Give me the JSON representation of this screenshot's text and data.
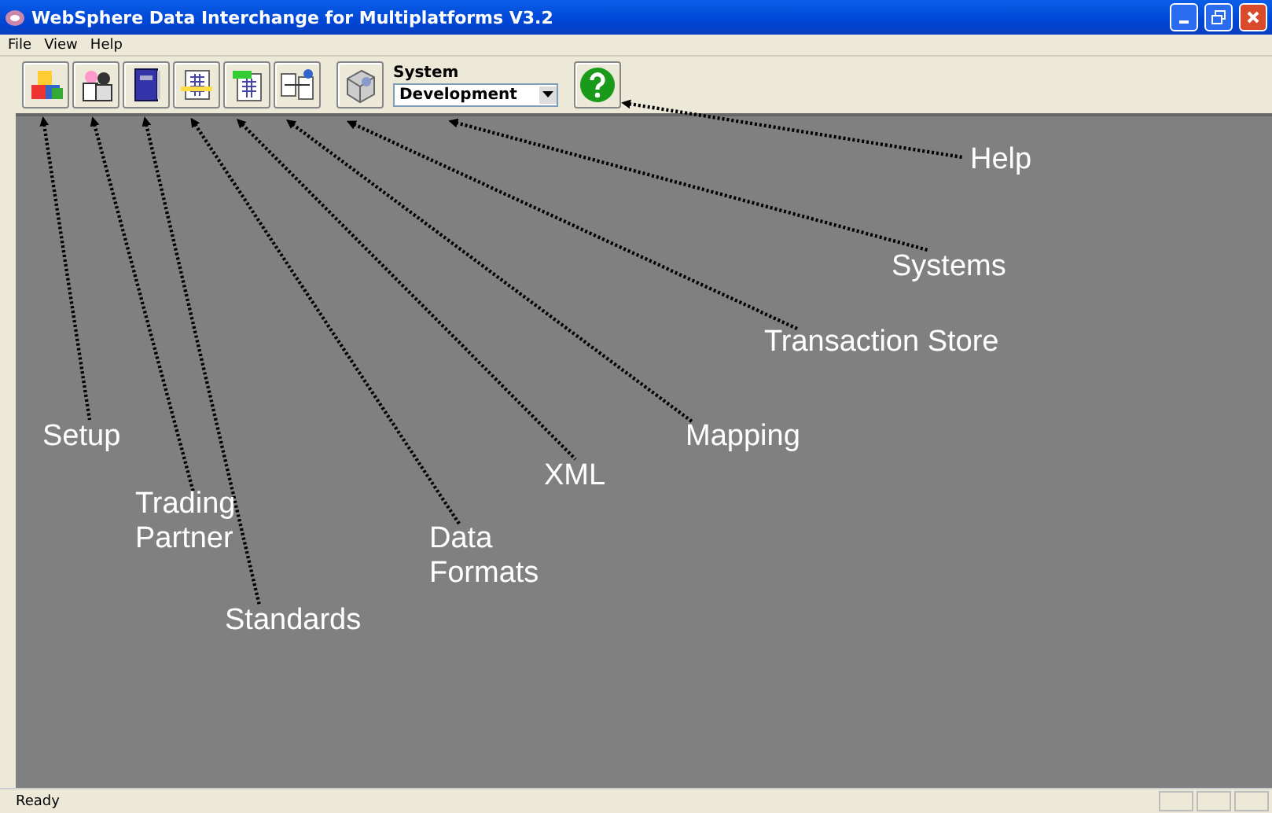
{
  "window": {
    "title": "WebSphere Data Interchange for Multiplatforms V3.2"
  },
  "menu": [
    "File",
    "View",
    "Help"
  ],
  "toolbar": {
    "system_label": "System",
    "system_value": "Development"
  },
  "annotations": [
    {
      "text": "Help"
    },
    {
      "text": "Systems"
    },
    {
      "text": "Transaction Store"
    },
    {
      "text": "Mapping"
    },
    {
      "text": "XML"
    },
    {
      "text": "Setup"
    },
    {
      "text": "Trading Partner"
    },
    {
      "text": "Data Formats"
    },
    {
      "text": "Standards"
    }
  ],
  "status_bar": {
    "text": "Ready"
  }
}
